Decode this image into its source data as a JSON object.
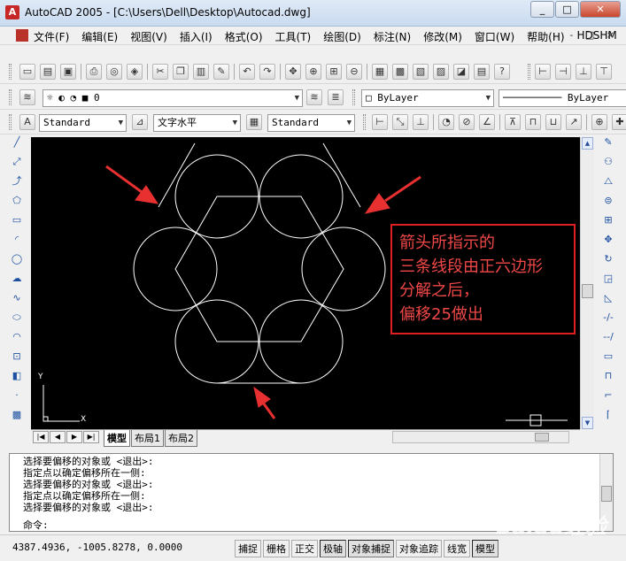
{
  "window": {
    "title": "AutoCAD 2005 - [C:\\Users\\Dell\\Desktop\\Autocad.dwg]",
    "minimize": "_",
    "maximize": "□",
    "close": "✕"
  },
  "menu": {
    "items": [
      "文件(F)",
      "编辑(E)",
      "视图(V)",
      "插入(I)",
      "格式(O)",
      "工具(T)",
      "绘图(D)",
      "标注(N)",
      "修改(M)",
      "窗口(W)",
      "帮助(H)",
      "HDSHM"
    ],
    "controls": "- □ ×"
  },
  "layer_toolbar": {
    "layer_value": "0",
    "color_value": "ByLayer",
    "linetype_value": "ByLayer"
  },
  "style_toolbar": {
    "text_style": "Standard",
    "dim_style": "文字水平",
    "table_style": "Standard"
  },
  "annotation": {
    "lines": [
      "箭头所指示的",
      "三条线段由正六边形",
      "分解之后，",
      "偏移25做出"
    ],
    "color": "#e02020"
  },
  "ucs": {
    "x_label": "X",
    "y_label": "Y"
  },
  "tabs": {
    "model": "模型",
    "layout1": "布局1",
    "layout2": "布局2"
  },
  "command_window": {
    "lines": [
      "选择要偏移的对象或 <退出>:",
      "指定点以确定偏移所在一侧:",
      "选择要偏移的对象或 <退出>:",
      "指定点以确定偏移所在一侧:",
      "选择要偏移的对象或 <退出>:"
    ],
    "prompt": "命令:"
  },
  "status": {
    "coords": "4387.4936, -1005.8278, 0.0000",
    "modes": [
      {
        "label": "捕捉",
        "on": false
      },
      {
        "label": "栅格",
        "on": false
      },
      {
        "label": "正交",
        "on": false
      },
      {
        "label": "极轴",
        "on": true
      },
      {
        "label": "对象捕捉",
        "on": true
      },
      {
        "label": "对象追踪",
        "on": false
      },
      {
        "label": "线宽",
        "on": false
      },
      {
        "label": "模型",
        "on": true
      }
    ]
  },
  "watermark": "Baidu经验"
}
